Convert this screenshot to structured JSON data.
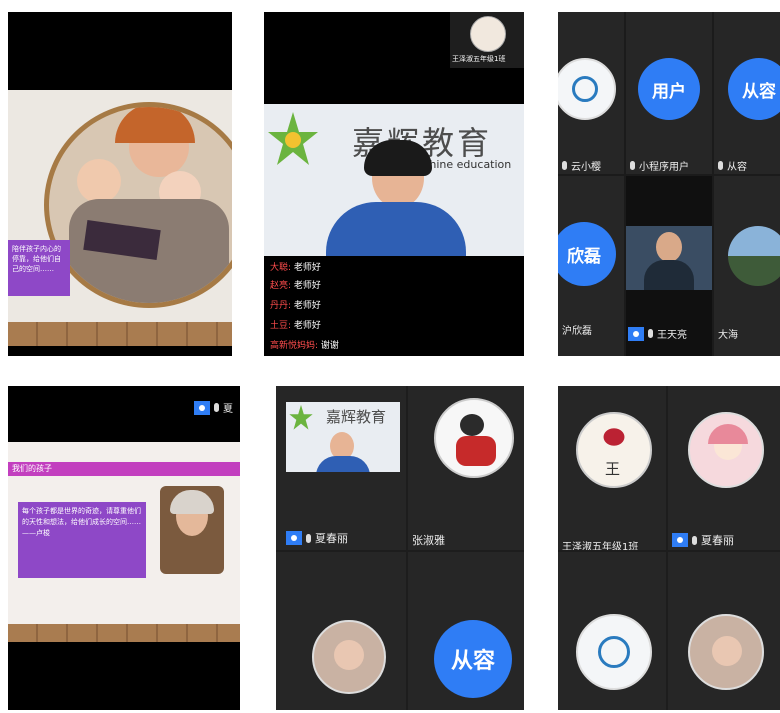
{
  "panel1": {
    "slide_text": "陪伴孩子内心的停靠，给他们自己的空间……"
  },
  "panel2": {
    "top_tile_label": "王泽淑五年级1班",
    "brand_cn": "嘉辉教育",
    "brand_en": "sunshine education",
    "chat": [
      {
        "who": "赵亮:",
        "msg": "老师好"
      },
      {
        "who": "丹丹:",
        "msg": "老师好"
      },
      {
        "who": "土豆:",
        "msg": "老师好"
      },
      {
        "who": "大聪:",
        "msg": "老师好"
      },
      {
        "who": "高新悦妈妈:",
        "msg": "谢谢"
      }
    ]
  },
  "panel3": {
    "avatar_user": "用户",
    "avatar_congrong": "从容",
    "avatar_xinlei": "欣磊",
    "name_1": "云小樱",
    "name_2": "小程序用户",
    "name_3": "从容",
    "name_4": "沪欣磊",
    "name_5": "王天亮",
    "name_6": "大海"
  },
  "panel4": {
    "top_name": "夏",
    "slide_title": "我们的孩子",
    "quote": "每个孩子都是世界的奇迹，请尊重他们的天性和想法，给他们成长的空间……",
    "quote_author": "——卢梭"
  },
  "panel5": {
    "brand_cn": "嘉辉教育",
    "name_1": "夏春丽",
    "name_2": "张淑雅",
    "avatar_congrong": "从容"
  },
  "panel6": {
    "name_1": "王泽淑五年级1班",
    "name_2": "夏春丽",
    "badge_char": "王"
  },
  "colors": {
    "accent_blue": "#2f7df5",
    "green_brand": "#6bb43f",
    "purple": "#8e48c7"
  }
}
